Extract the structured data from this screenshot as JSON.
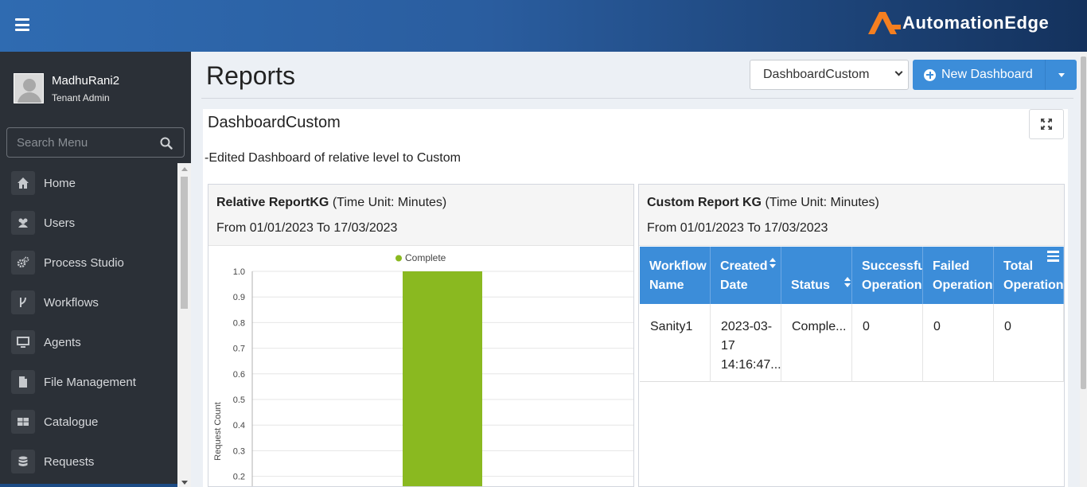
{
  "app": {
    "brand": "AutomationEdge",
    "brand_color": "#f47f20",
    "accent": "#3c8dd9"
  },
  "user": {
    "name": "MadhuRani2",
    "role": "Tenant Admin"
  },
  "search": {
    "placeholder": "Search Menu"
  },
  "menu": [
    {
      "label": "Home",
      "icon": "home-icon"
    },
    {
      "label": "Users",
      "icon": "users-icon"
    },
    {
      "label": "Process Studio",
      "icon": "gears-icon"
    },
    {
      "label": "Workflows",
      "icon": "branch-icon"
    },
    {
      "label": "Agents",
      "icon": "desktop-icon"
    },
    {
      "label": "File Management",
      "icon": "file-icon"
    },
    {
      "label": "Catalogue",
      "icon": "grid-icon"
    },
    {
      "label": "Requests",
      "icon": "database-icon"
    }
  ],
  "page": {
    "title": "Reports",
    "selected_dashboard": "DashboardCustom",
    "new_dashboard_label": "New Dashboard"
  },
  "dashboard": {
    "name": "DashboardCustom",
    "description": "-Edited Dashboard of relative level to Custom"
  },
  "reports": {
    "left": {
      "title": "Relative ReportKG",
      "unit": "(Time Unit: Minutes)",
      "range": "From 01/01/2023 To 17/03/2023"
    },
    "right": {
      "title": "Custom Report KG",
      "unit": "(Time Unit: Minutes)",
      "range": "From 01/01/2023 To 17/03/2023"
    }
  },
  "chart_data": {
    "type": "bar",
    "legend": [
      "Complete"
    ],
    "legend_position": "top",
    "series": [
      {
        "name": "Complete",
        "values": [
          1.0
        ],
        "color": "#8ab920"
      }
    ],
    "ylabel": "Request Count",
    "yticks": [
      "1.0",
      "0.9",
      "0.8",
      "0.7",
      "0.6",
      "0.5",
      "0.4",
      "0.3",
      "0.2"
    ],
    "ylim": [
      0,
      1.0
    ],
    "grid": true
  },
  "table": {
    "columns": [
      {
        "l1": "Workflow",
        "l2": "Name",
        "sortable": false
      },
      {
        "l1": "Created",
        "l2": "Date",
        "sortable": true
      },
      {
        "l1": "",
        "l2": "Status",
        "sortable": true
      },
      {
        "l1": "Successful",
        "l2": "Operation",
        "sortable": false
      },
      {
        "l1": "Failed",
        "l2": "Operation",
        "sortable": false
      },
      {
        "l1": "Total",
        "l2": "Operation",
        "sortable": false
      }
    ],
    "rows": [
      [
        "Sanity1",
        "2023-03-17 14:16:47...",
        "Comple...",
        "0",
        "0",
        "0"
      ]
    ]
  }
}
